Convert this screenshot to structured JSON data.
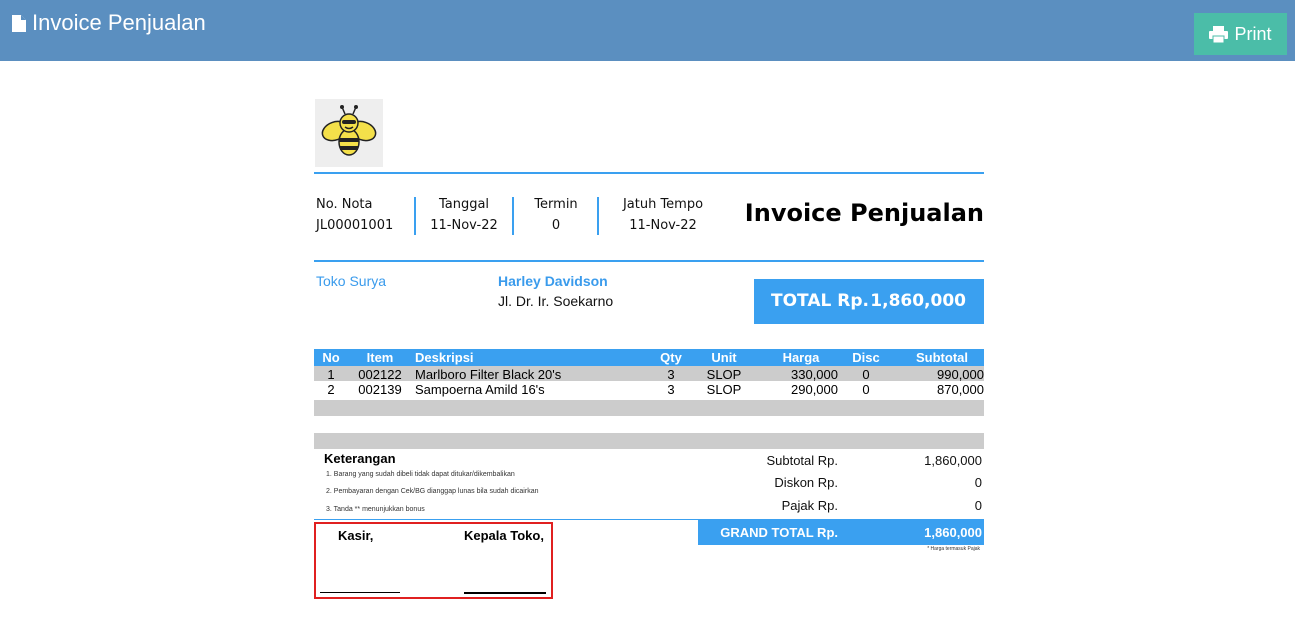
{
  "topbar": {
    "title": "Invoice Penjualan",
    "print_label": "Print"
  },
  "invoice": {
    "meta": {
      "no_nota_label": "No. Nota",
      "no_nota": "JL00001001",
      "tanggal_label": "Tanggal",
      "tanggal": "11-Nov-22",
      "termin_label": "Termin",
      "termin": "0",
      "jatuh_tempo_label": "Jatuh Tempo",
      "jatuh_tempo": "11-Nov-22"
    },
    "title": "Invoice Penjualan",
    "shop_name": "Toko Surya",
    "customer": {
      "name": "Harley Davidson",
      "address": "Jl. Dr. Ir. Soekarno"
    },
    "total": {
      "label": "TOTAL Rp.",
      "value": "1,860,000"
    },
    "table": {
      "headers": {
        "no": "No",
        "item": "Item",
        "desc": "Deskripsi",
        "qty": "Qty",
        "unit": "Unit",
        "price": "Harga",
        "disc": "Disc",
        "subtotal": "Subtotal"
      },
      "rows": [
        {
          "no": "1",
          "item": "002122",
          "desc": "Marlboro Filter Black 20's",
          "qty": "3",
          "unit": "SLOP",
          "price": "330,000",
          "disc": "0",
          "subtotal": "990,000"
        },
        {
          "no": "2",
          "item": "002139",
          "desc": "Sampoerna Amild 16's",
          "qty": "3",
          "unit": "SLOP",
          "price": "290,000",
          "disc": "0",
          "subtotal": "870,000"
        }
      ]
    },
    "notes": {
      "title": "Keterangan",
      "items": [
        "1. Barang yang sudah dibeli tidak dapat ditukar/dikembalikan",
        "2. Pembayaran dengan Cek/BG dianggap lunas bila sudah dicairkan",
        "3. Tanda ** menunjukkan bonus"
      ]
    },
    "summary": {
      "subtotal_label": "Subtotal Rp.",
      "subtotal": "1,860,000",
      "discount_label": "Diskon Rp.",
      "discount": "0",
      "tax_label": "Pajak Rp.",
      "tax": "0",
      "grand_label": "GRAND TOTAL Rp.",
      "grand": "1,860,000",
      "tax_note": "* Harga termasuk Pajak"
    },
    "signatures": {
      "cashier": "Kasir,",
      "manager": "Kepala Toko,"
    }
  },
  "colors": {
    "topbar": "#5b8fc0",
    "print_button": "#4bbda8",
    "accent": "#3aa0f0",
    "highlight_border": "#e02020"
  }
}
